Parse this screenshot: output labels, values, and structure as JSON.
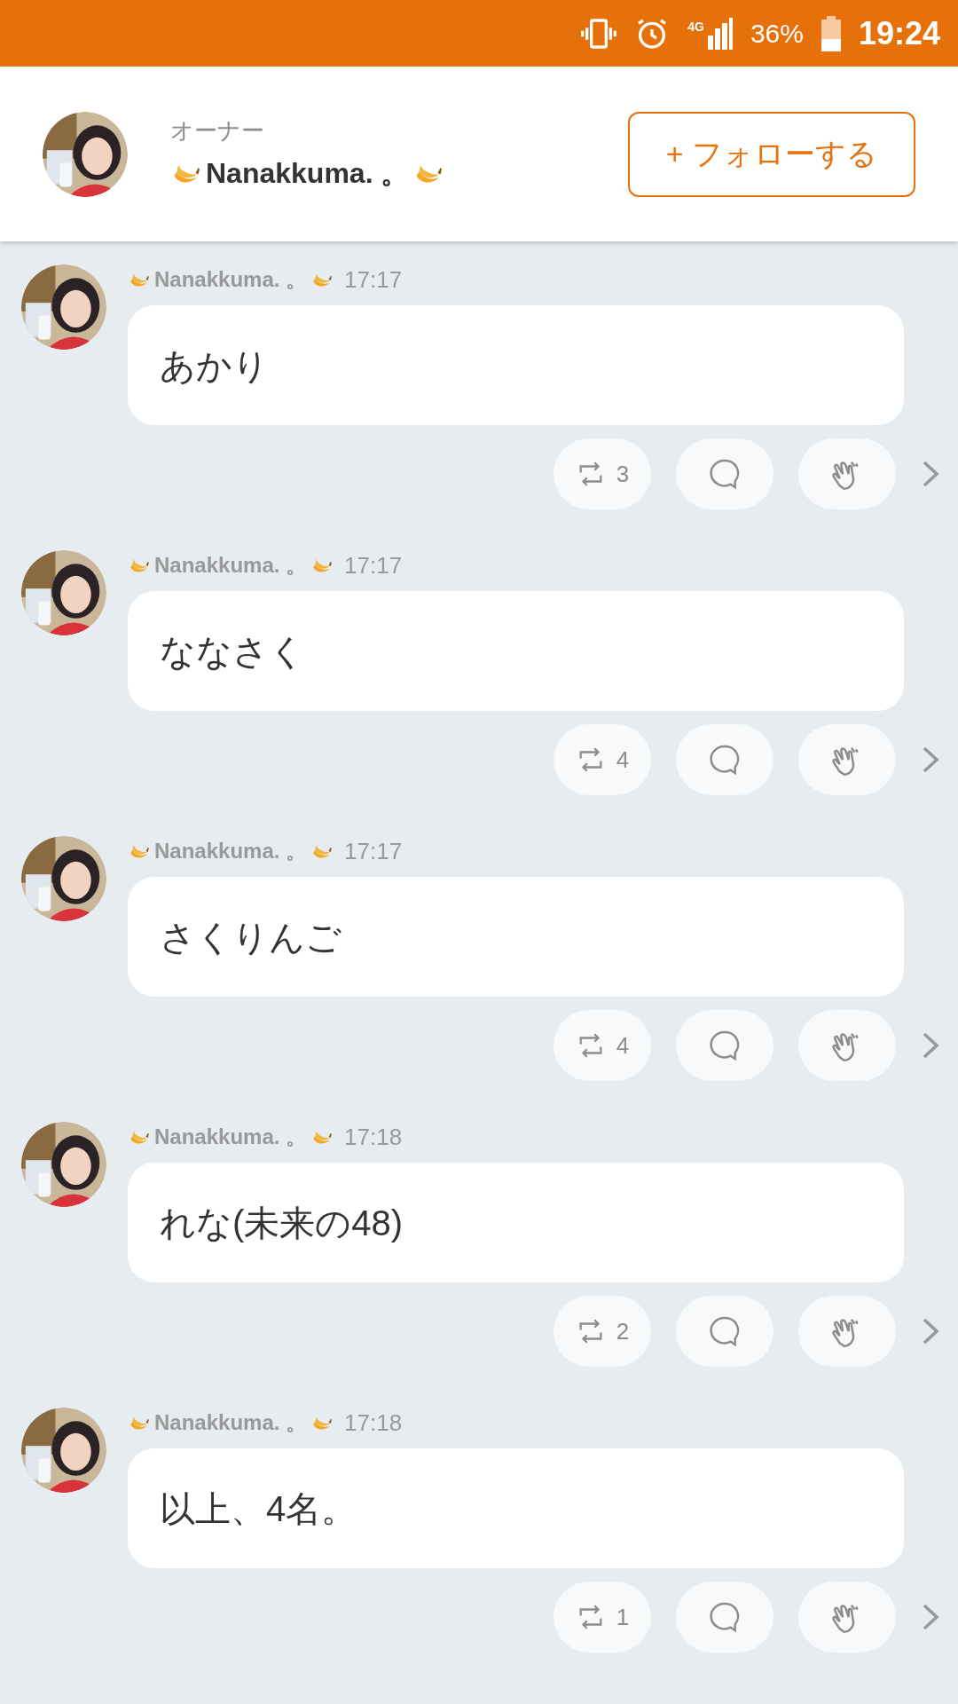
{
  "status_bar": {
    "battery": "36%",
    "time": "19:24",
    "network": "4G"
  },
  "header": {
    "role": "オーナー",
    "name": "Nanakkuma. 。",
    "follow_button": "+ フォローする"
  },
  "messages": [
    {
      "author": "Nanakkuma. 。",
      "time": "17:17",
      "text": "あかり",
      "repost_count": "3"
    },
    {
      "author": "Nanakkuma. 。",
      "time": "17:17",
      "text": "ななさく",
      "repost_count": "4"
    },
    {
      "author": "Nanakkuma. 。",
      "time": "17:17",
      "text": "さくりんご",
      "repost_count": "4"
    },
    {
      "author": "Nanakkuma. 。",
      "time": "17:18",
      "text": "れな(未来の48)",
      "repost_count": "2"
    },
    {
      "author": "Nanakkuma. 。",
      "time": "17:18",
      "text": "以上、4名。",
      "repost_count": "1"
    }
  ]
}
